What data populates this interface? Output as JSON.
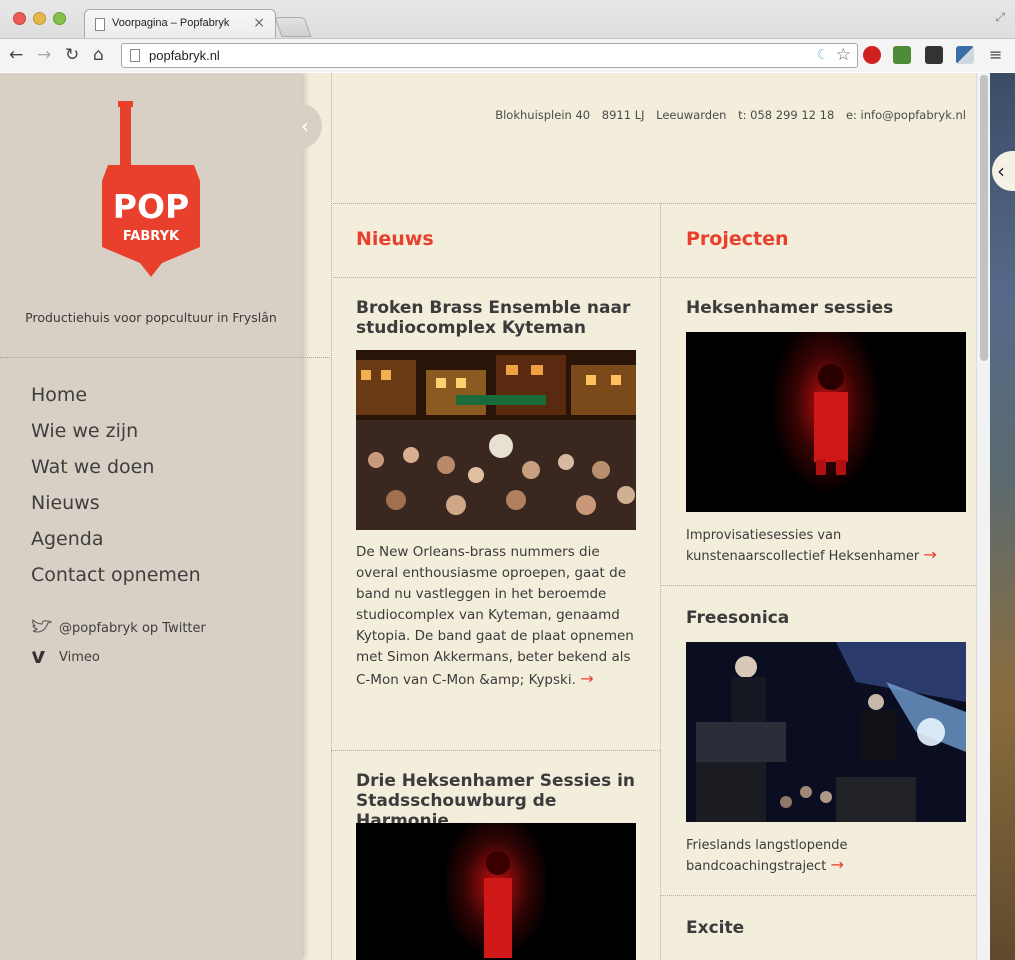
{
  "browser": {
    "tab_title": "Voorpagina – Popfabryk",
    "tab_close": "×",
    "url": "popfabryk.nl",
    "icons": [
      "back-icon",
      "forward-icon",
      "reload-icon",
      "home-icon",
      "star-icon",
      "menu-icon"
    ]
  },
  "sidebar": {
    "logo_top": "POP",
    "logo_bottom": "FABRYK",
    "tagline": "Productiehuis voor popcultuur in Fryslân",
    "nav": [
      "Home",
      "Wie we zijn",
      "Wat we doen",
      "Nieuws",
      "Agenda",
      "Contact opnemen"
    ],
    "social": [
      {
        "label": "@popfabryk op Twitter",
        "icon": "twitter-icon"
      },
      {
        "label": "Vimeo",
        "icon": "vimeo-icon"
      }
    ]
  },
  "contact": {
    "address": "Blokhuisplein 40",
    "postcode": "8911 LJ",
    "city": "Leeuwarden",
    "phone": "t: 058 299 12 18",
    "email": "e: info@popfabryk.nl"
  },
  "news": {
    "title": "Nieuws",
    "articles": [
      {
        "title": "Broken Brass Ensemble naar studiocomplex Kyteman",
        "body": "De New Orleans-brass nummers die overal enthousiasme oproepen, gaat de band nu vastleggen in het beroemde studiocomplex van Kyteman, genaamd Kytopia. De band gaat de plaat opnemen met Simon Akkermans, beter bekend als C-Mon van C-Mon &amp; Kypski.",
        "arrow": "→"
      },
      {
        "title": "Drie Heksenhamer Sessies in Stadsschouwburg de Harmonie"
      }
    ]
  },
  "projects": {
    "title": "Projecten",
    "items": [
      {
        "title": "Heksenhamer sessies",
        "desc": "Improvisatiesessies van kunstenaarscollectief Heksenhamer",
        "arrow": "→"
      },
      {
        "title": "Freesonica",
        "desc": "Frieslands langstlopende bandcoachingstraject",
        "arrow": "→"
      },
      {
        "title": "Excite"
      }
    ]
  },
  "colors": {
    "accent": "#e8402c",
    "sidebar_bg": "#d9d0c5",
    "content_bg": "#f3eedc",
    "text": "#3b3b3b"
  }
}
